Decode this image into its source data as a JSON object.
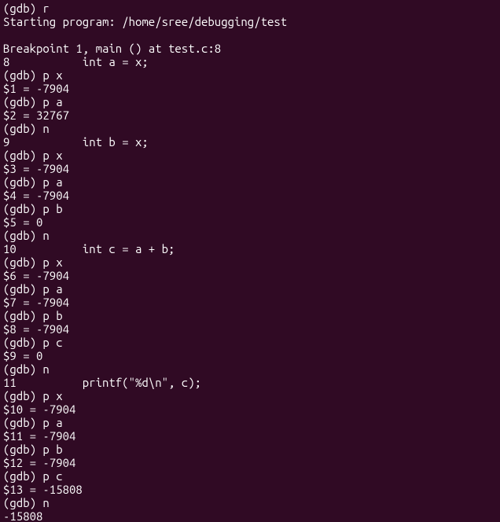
{
  "lines": [
    "(gdb) r",
    "Starting program: /home/sree/debugging/test",
    "",
    "Breakpoint 1, main () at test.c:8",
    "8           int a = x;",
    "(gdb) p x",
    "$1 = -7904",
    "(gdb) p a",
    "$2 = 32767",
    "(gdb) n",
    "9           int b = x;",
    "(gdb) p x",
    "$3 = -7904",
    "(gdb) p a",
    "$4 = -7904",
    "(gdb) p b",
    "$5 = 0",
    "(gdb) n",
    "10          int c = a + b;",
    "(gdb) p x",
    "$6 = -7904",
    "(gdb) p a",
    "$7 = -7904",
    "(gdb) p b",
    "$8 = -7904",
    "(gdb) p c",
    "$9 = 0",
    "(gdb) n",
    "11          printf(\"%d\\n\", c);",
    "(gdb) p x",
    "$10 = -7904",
    "(gdb) p a",
    "$11 = -7904",
    "(gdb) p b",
    "$12 = -7904",
    "(gdb) p c",
    "$13 = -15808",
    "(gdb) n",
    "-15808"
  ]
}
